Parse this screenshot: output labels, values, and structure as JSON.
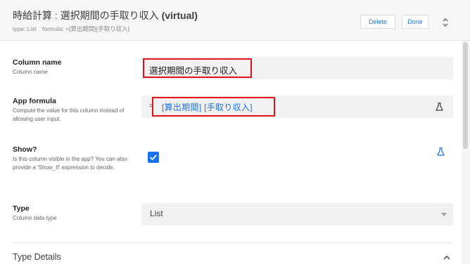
{
  "header": {
    "title_prefix": "時給計算 : 選択期間の手取り収入 ",
    "title_suffix": "(virtual)",
    "type_label": "type: List",
    "formula_label": "formula: =[算出期間][手取り収入]",
    "delete_label": "Delete",
    "done_label": "Done"
  },
  "fields": {
    "column_name": {
      "label": "Column name",
      "description": "Column name",
      "value": "選択期間の手取り収入"
    },
    "app_formula": {
      "label": "App formula",
      "description": "Compute the value for this column instead of allowing user input.",
      "equals_sign": "=",
      "value": "[算出期間] [手取り収入]"
    },
    "show": {
      "label": "Show?",
      "description": "Is this column visible in the app? You can also provide a 'Show_If' expression to decide.",
      "checked": true
    },
    "type": {
      "label": "Type",
      "description": "Column data type",
      "value": "List"
    }
  },
  "section": {
    "type_details": "Type Details"
  },
  "colors": {
    "accent": "#1a73e8",
    "highlight": "#e0131c"
  },
  "icons": {
    "formula_test": "flask-icon",
    "show_test": "flask-icon",
    "collapse": "unfold-icon",
    "dropdown": "caret-down-icon",
    "section_toggle": "chevron-up-icon",
    "checkbox": "check-icon"
  }
}
